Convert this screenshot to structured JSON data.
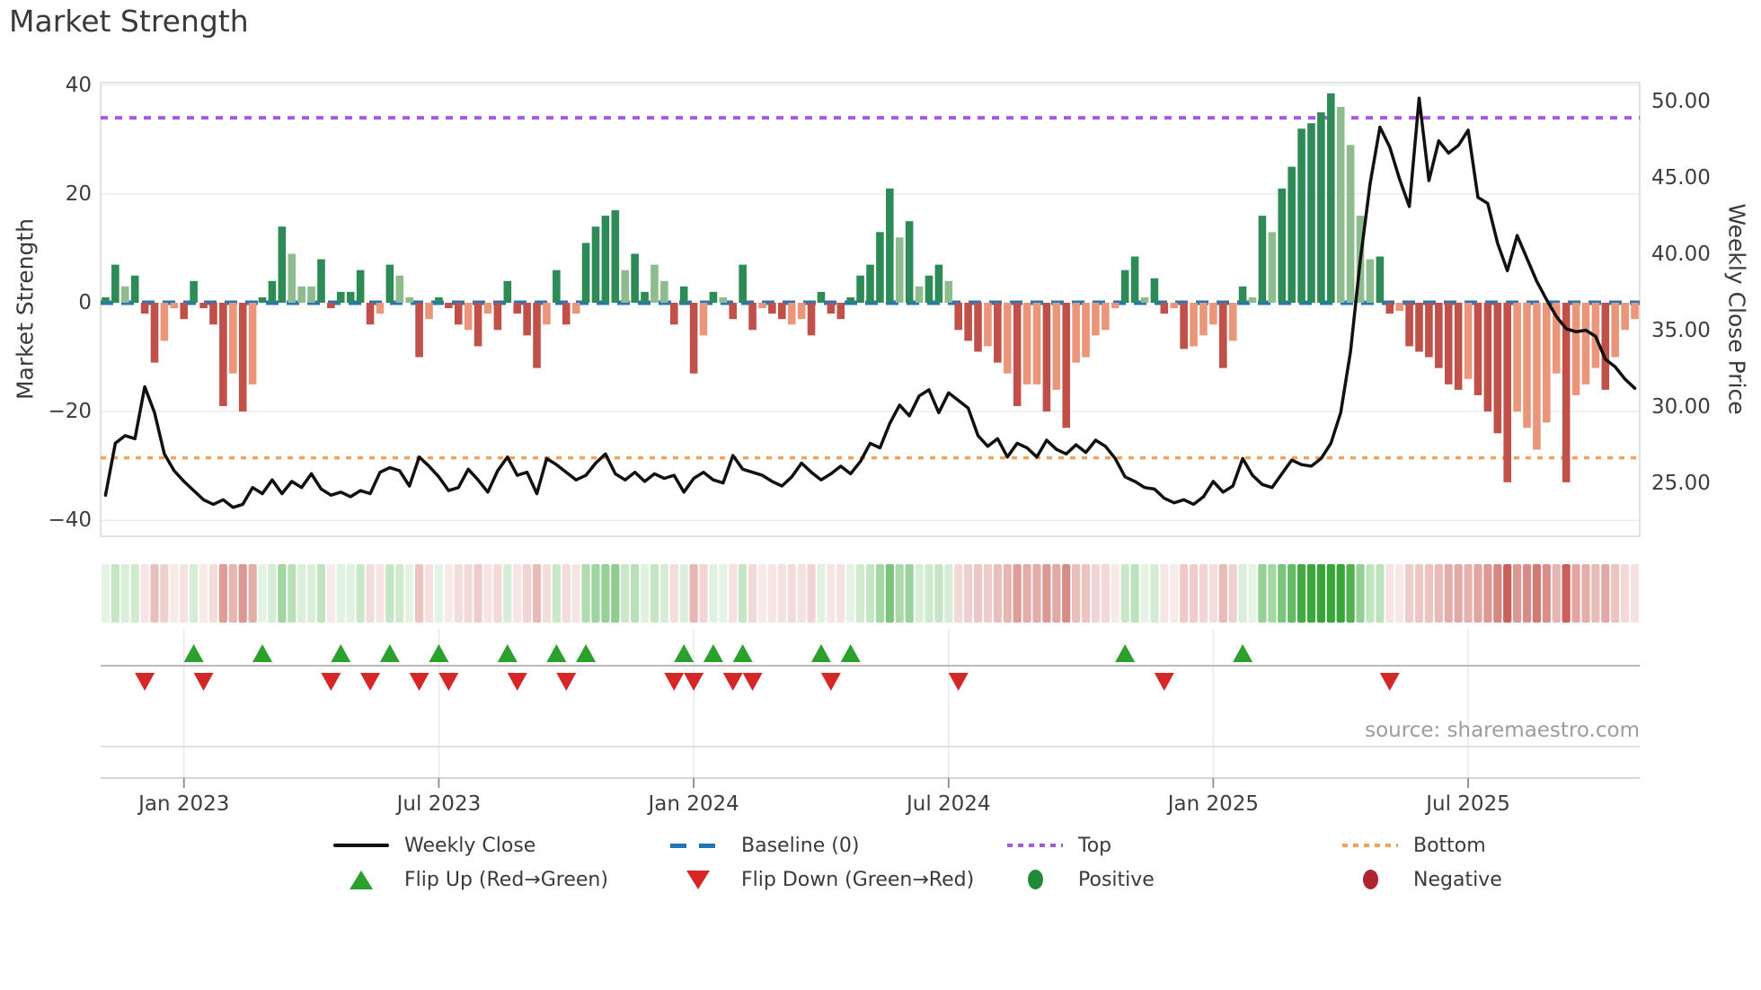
{
  "title": "Market Strength",
  "source_note": "source: sharemaestro.com",
  "axes": {
    "left": {
      "label": "Market Strength",
      "ticks": [
        "40",
        "20",
        "0",
        "−20",
        "−40"
      ],
      "tick_values": [
        40,
        20,
        0,
        -20,
        -40
      ]
    },
    "right": {
      "label": "Weekly Close Price",
      "ticks": [
        "50.00",
        "45.00",
        "40.00",
        "35.00",
        "30.00",
        "25.00"
      ],
      "tick_values": [
        50,
        45,
        40,
        35,
        30,
        25
      ]
    },
    "x": {
      "ticks": [
        "Jan 2023",
        "Jul 2023",
        "Jan 2024",
        "Jul 2024",
        "Jan 2025",
        "Jul 2025"
      ],
      "tick_weeks": [
        8,
        34,
        60,
        86,
        113,
        139
      ]
    }
  },
  "legend": {
    "rows": [
      {
        "items": [
          {
            "label": "Weekly Close",
            "swatch": "line-black"
          },
          {
            "label": "Baseline (0)",
            "swatch": "dash-blue"
          },
          {
            "label": "Top",
            "swatch": "dot-purple"
          },
          {
            "label": "Bottom",
            "swatch": "dot-orange"
          }
        ]
      },
      {
        "items": [
          {
            "label": "Flip Up (Red→Green)",
            "swatch": "triangle-up-green"
          },
          {
            "label": "Flip Down (Green→Red)",
            "swatch": "triangle-down-red"
          },
          {
            "label": "Positive",
            "swatch": "circle-green"
          },
          {
            "label": "Negative",
            "swatch": "circle-red"
          }
        ]
      }
    ]
  },
  "colors": {
    "bar_pos_strong": "#2e8b57",
    "bar_pos_weak": "#8fbc8f",
    "bar_neg_strong": "#c0504a",
    "bar_neg_weak": "#e9967a",
    "baseline": "#2676b8",
    "top_line": "#a25be0",
    "bottom_line": "#f2a25f",
    "price_line": "#111111",
    "flip_up": "#2ca02c",
    "flip_down": "#d62728",
    "grid": "#ececec",
    "spine": "#d9d9d9"
  },
  "chart_data": {
    "type": "bar+line",
    "title": "Market Strength",
    "x_unit": "week",
    "start_date": "2022-11-07",
    "weeks": 157,
    "left_ylim": [
      -43.2,
      40.5
    ],
    "right_ylim": [
      21.5,
      51.2
    ],
    "baseline": 0,
    "top_line": 34,
    "bottom_line": -28.5,
    "grid": "horizontal-only",
    "legend_position": "bottom",
    "series": [
      {
        "name": "Market Strength",
        "type": "bar",
        "axis": "left",
        "values": [
          1,
          7,
          3,
          5,
          -2,
          -11,
          -7,
          -1,
          -3,
          4,
          -1,
          -4,
          -19,
          -13,
          -20,
          -15,
          1,
          4,
          14,
          9,
          3,
          3,
          8,
          -1,
          2,
          2,
          6,
          -4,
          -2,
          7,
          5,
          1,
          -10,
          -3,
          1,
          -1,
          -4,
          -5,
          -8,
          -2,
          -5,
          4,
          -2,
          -6,
          -12,
          -4,
          6,
          -4,
          -2,
          11,
          14,
          16,
          17,
          6,
          9,
          2,
          7,
          4,
          -4,
          3,
          -13,
          -6,
          2,
          1,
          -3,
          7,
          -5,
          -1,
          -2,
          -3,
          -4,
          -3,
          -6,
          2,
          -2,
          -3,
          1,
          5,
          7,
          13,
          21,
          12,
          15,
          3,
          5,
          7,
          4,
          -5,
          -7,
          -9,
          -8,
          -11,
          -13,
          -19,
          -15,
          -15,
          -20,
          -16,
          -23,
          -11,
          -10,
          -6,
          -5,
          -1,
          6,
          8.5,
          1,
          4.5,
          -2,
          -1,
          -8.5,
          -8,
          -6,
          -4,
          -12,
          -7,
          3,
          1,
          16,
          13,
          21,
          25,
          32,
          33,
          35,
          38.5,
          36,
          29,
          16,
          8,
          8.5,
          -2,
          -1.5,
          -8,
          -9,
          -10,
          -12,
          -15,
          -16,
          -14,
          -17,
          -20,
          -24,
          -33,
          -20,
          -23,
          -27,
          -22,
          -13,
          -33,
          -17,
          -15,
          -12,
          -16,
          -10,
          -5,
          -3
        ],
        "tones": [
          "ddldddlldd",
          "dddldldddl",
          "llddddddld",
          "lldldddldl",
          "dddddlddld",
          "dddlddlldd",
          "dldldddldd",
          "lldddddddd",
          "dldlddlddd",
          "ldldlldldl",
          "llllddlddl",
          "dllldldldl",
          "ddddddllll",
          "ddlddddddl",
          "ddddllllld",
          "llldlll"
        ]
      },
      {
        "name": "Weekly Close",
        "type": "line",
        "axis": "right",
        "values": [
          24.2,
          27.6,
          28.1,
          27.9,
          31.3,
          29.6,
          26.9,
          25.8,
          25.1,
          24.5,
          23.9,
          23.6,
          23.9,
          23.4,
          23.6,
          24.7,
          24.3,
          25.2,
          24.3,
          25.1,
          24.7,
          25.6,
          24.6,
          24.2,
          24.4,
          24.1,
          24.5,
          24.3,
          25.7,
          26.0,
          25.8,
          24.8,
          26.7,
          26.1,
          25.4,
          24.5,
          24.7,
          25.9,
          25.2,
          24.4,
          25.8,
          26.7,
          25.5,
          25.7,
          24.3,
          26.6,
          26.2,
          25.7,
          25.2,
          25.5,
          26.3,
          26.9,
          25.6,
          25.2,
          25.7,
          25.1,
          25.6,
          25.3,
          25.5,
          24.4,
          25.3,
          25.7,
          25.2,
          25.0,
          26.8,
          25.9,
          25.7,
          25.5,
          25.1,
          24.8,
          25.4,
          26.3,
          25.7,
          25.2,
          25.6,
          26.1,
          25.6,
          26.4,
          27.6,
          27.3,
          28.9,
          30.1,
          29.4,
          30.7,
          31.1,
          29.6,
          30.9,
          30.4,
          29.9,
          28.1,
          27.4,
          27.9,
          26.7,
          27.6,
          27.3,
          26.7,
          27.8,
          27.2,
          26.9,
          27.5,
          27.0,
          27.8,
          27.4,
          26.6,
          25.4,
          25.1,
          24.7,
          24.6,
          24.0,
          23.7,
          23.9,
          23.6,
          24.1,
          25.1,
          24.4,
          24.8,
          26.6,
          25.5,
          24.9,
          24.7,
          25.6,
          26.5,
          26.2,
          26.1,
          26.6,
          27.6,
          29.6,
          33.6,
          39.6,
          44.6,
          48.3,
          47.0,
          44.9,
          43.1,
          50.2,
          44.8,
          47.4,
          46.6,
          47.1,
          48.1,
          43.7,
          43.3,
          40.7,
          38.9,
          41.2,
          39.7,
          38.2,
          37.0,
          35.9,
          35.1,
          34.9,
          35.0,
          34.6,
          33.1,
          32.6,
          31.8,
          31.2
        ]
      }
    ],
    "flip_up_weeks": [
      9,
      16,
      24,
      29,
      34,
      41,
      46,
      49,
      59,
      62,
      65,
      73,
      76,
      104,
      116
    ],
    "flip_down_weeks": [
      4,
      10,
      23,
      27,
      32,
      35,
      42,
      47,
      58,
      60,
      64,
      66,
      74,
      87,
      108,
      131
    ]
  }
}
